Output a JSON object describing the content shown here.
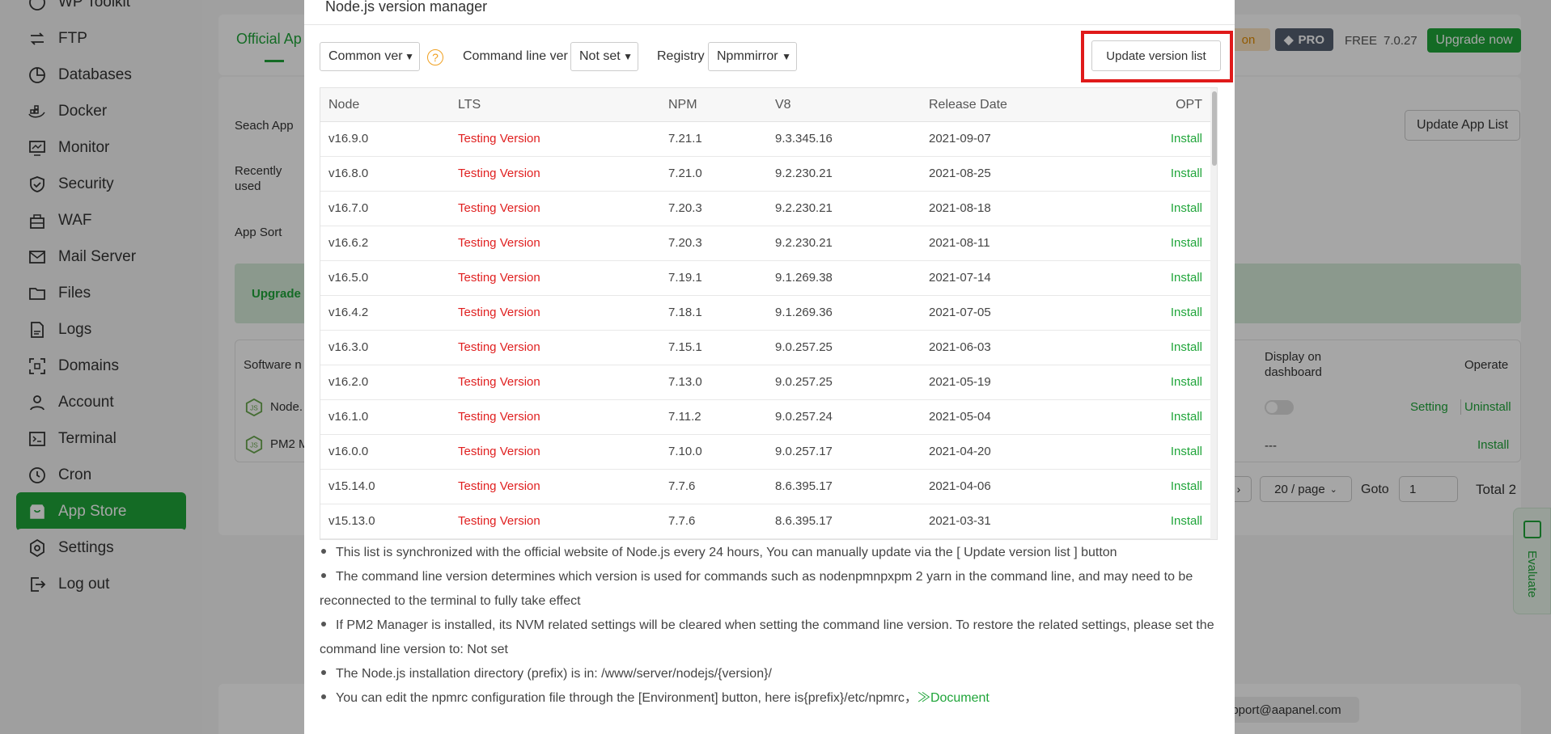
{
  "sidebar": {
    "items": [
      {
        "label": "WP Toolkit",
        "icon": "wordpress-icon"
      },
      {
        "label": "FTP",
        "icon": "ftp-icon"
      },
      {
        "label": "Databases",
        "icon": "database-icon"
      },
      {
        "label": "Docker",
        "icon": "docker-icon"
      },
      {
        "label": "Monitor",
        "icon": "monitor-icon"
      },
      {
        "label": "Security",
        "icon": "shield-icon"
      },
      {
        "label": "WAF",
        "icon": "waf-icon"
      },
      {
        "label": "Mail Server",
        "icon": "mail-icon"
      },
      {
        "label": "Files",
        "icon": "folder-icon"
      },
      {
        "label": "Logs",
        "icon": "logs-icon"
      },
      {
        "label": "Domains",
        "icon": "domains-icon"
      },
      {
        "label": "Account",
        "icon": "user-icon"
      },
      {
        "label": "Terminal",
        "icon": "terminal-icon"
      },
      {
        "label": "Cron",
        "icon": "clock-icon"
      },
      {
        "label": "App Store",
        "icon": "app-store-icon"
      },
      {
        "label": "Settings",
        "icon": "gear-icon"
      },
      {
        "label": "Log out",
        "icon": "logout-icon"
      }
    ],
    "active": "App Store"
  },
  "background": {
    "tab_official": "Official Ap",
    "search_label": "Seach App",
    "recent_label": "Recently used",
    "sort_label": "App Sort",
    "upgrade_text": "Upgrade",
    "update_app_list": "Update App List",
    "orange_tag": "on",
    "pro": "PRO",
    "free": "FREE",
    "version": "7.0.27",
    "upgrade_now": "Upgrade now",
    "col_software": "Software n",
    "col_display": "Display on dashboard",
    "col_operate": "Operate",
    "row1_name": "Node.",
    "row1_setting": "Setting",
    "row1_uninstall": "Uninstall",
    "row2_name": "PM2 M",
    "row2_display": "---",
    "row2_install": "Install",
    "per_page": "20 / page",
    "goto_label": "Goto",
    "goto_value": "1",
    "total": "Total 2",
    "evaluate": "Evaluate",
    "support_email": "pport@aapanel.com"
  },
  "modal": {
    "title": "Node.js version manager",
    "common_ver": "Common ver",
    "cmd_label": "Command line ver",
    "cmd_value": "Not set",
    "registry_label": "Registry",
    "registry_value": "Npmmirror",
    "update_button": "Update version list",
    "help_icon": "question-icon",
    "columns": [
      "Node",
      "LTS",
      "NPM",
      "V8",
      "Release Date",
      "OPT"
    ],
    "rows": [
      {
        "node": "v16.9.0",
        "lts": "Testing Version",
        "npm": "7.21.1",
        "v8": "9.3.345.16",
        "date": "2021-09-07",
        "opt": "Install"
      },
      {
        "node": "v16.8.0",
        "lts": "Testing Version",
        "npm": "7.21.0",
        "v8": "9.2.230.21",
        "date": "2021-08-25",
        "opt": "Install"
      },
      {
        "node": "v16.7.0",
        "lts": "Testing Version",
        "npm": "7.20.3",
        "v8": "9.2.230.21",
        "date": "2021-08-18",
        "opt": "Install"
      },
      {
        "node": "v16.6.2",
        "lts": "Testing Version",
        "npm": "7.20.3",
        "v8": "9.2.230.21",
        "date": "2021-08-11",
        "opt": "Install"
      },
      {
        "node": "v16.5.0",
        "lts": "Testing Version",
        "npm": "7.19.1",
        "v8": "9.1.269.38",
        "date": "2021-07-14",
        "opt": "Install"
      },
      {
        "node": "v16.4.2",
        "lts": "Testing Version",
        "npm": "7.18.1",
        "v8": "9.1.269.36",
        "date": "2021-07-05",
        "opt": "Install"
      },
      {
        "node": "v16.3.0",
        "lts": "Testing Version",
        "npm": "7.15.1",
        "v8": "9.0.257.25",
        "date": "2021-06-03",
        "opt": "Install"
      },
      {
        "node": "v16.2.0",
        "lts": "Testing Version",
        "npm": "7.13.0",
        "v8": "9.0.257.25",
        "date": "2021-05-19",
        "opt": "Install"
      },
      {
        "node": "v16.1.0",
        "lts": "Testing Version",
        "npm": "7.11.2",
        "v8": "9.0.257.24",
        "date": "2021-05-04",
        "opt": "Install"
      },
      {
        "node": "v16.0.0",
        "lts": "Testing Version",
        "npm": "7.10.0",
        "v8": "9.0.257.17",
        "date": "2021-04-20",
        "opt": "Install"
      },
      {
        "node": "v15.14.0",
        "lts": "Testing Version",
        "npm": "7.7.6",
        "v8": "8.6.395.17",
        "date": "2021-04-06",
        "opt": "Install"
      },
      {
        "node": "v15.13.0",
        "lts": "Testing Version",
        "npm": "7.7.6",
        "v8": "8.6.395.17",
        "date": "2021-03-31",
        "opt": "Install"
      }
    ],
    "notes": [
      "This list is synchronized with the official website of Node.js every 24 hours, You can manually update via the [ Update version list ] button",
      "The command line version determines which version is used for commands such as nodenpmnpxpm 2 yarn in the command line, and may need to be reconnected to the terminal to fully take effect",
      "If PM2 Manager is installed, its NVM related settings will be cleared when setting the command line version. To restore the related settings, please set the command line version to: Not set",
      "The Node.js installation directory (prefix) is in: /www/server/nodejs/{version}/",
      "You can edit the npmrc configuration file through the [Environment] button, here is{prefix}/etc/npmrc，"
    ],
    "doc_link": "≫Document"
  }
}
